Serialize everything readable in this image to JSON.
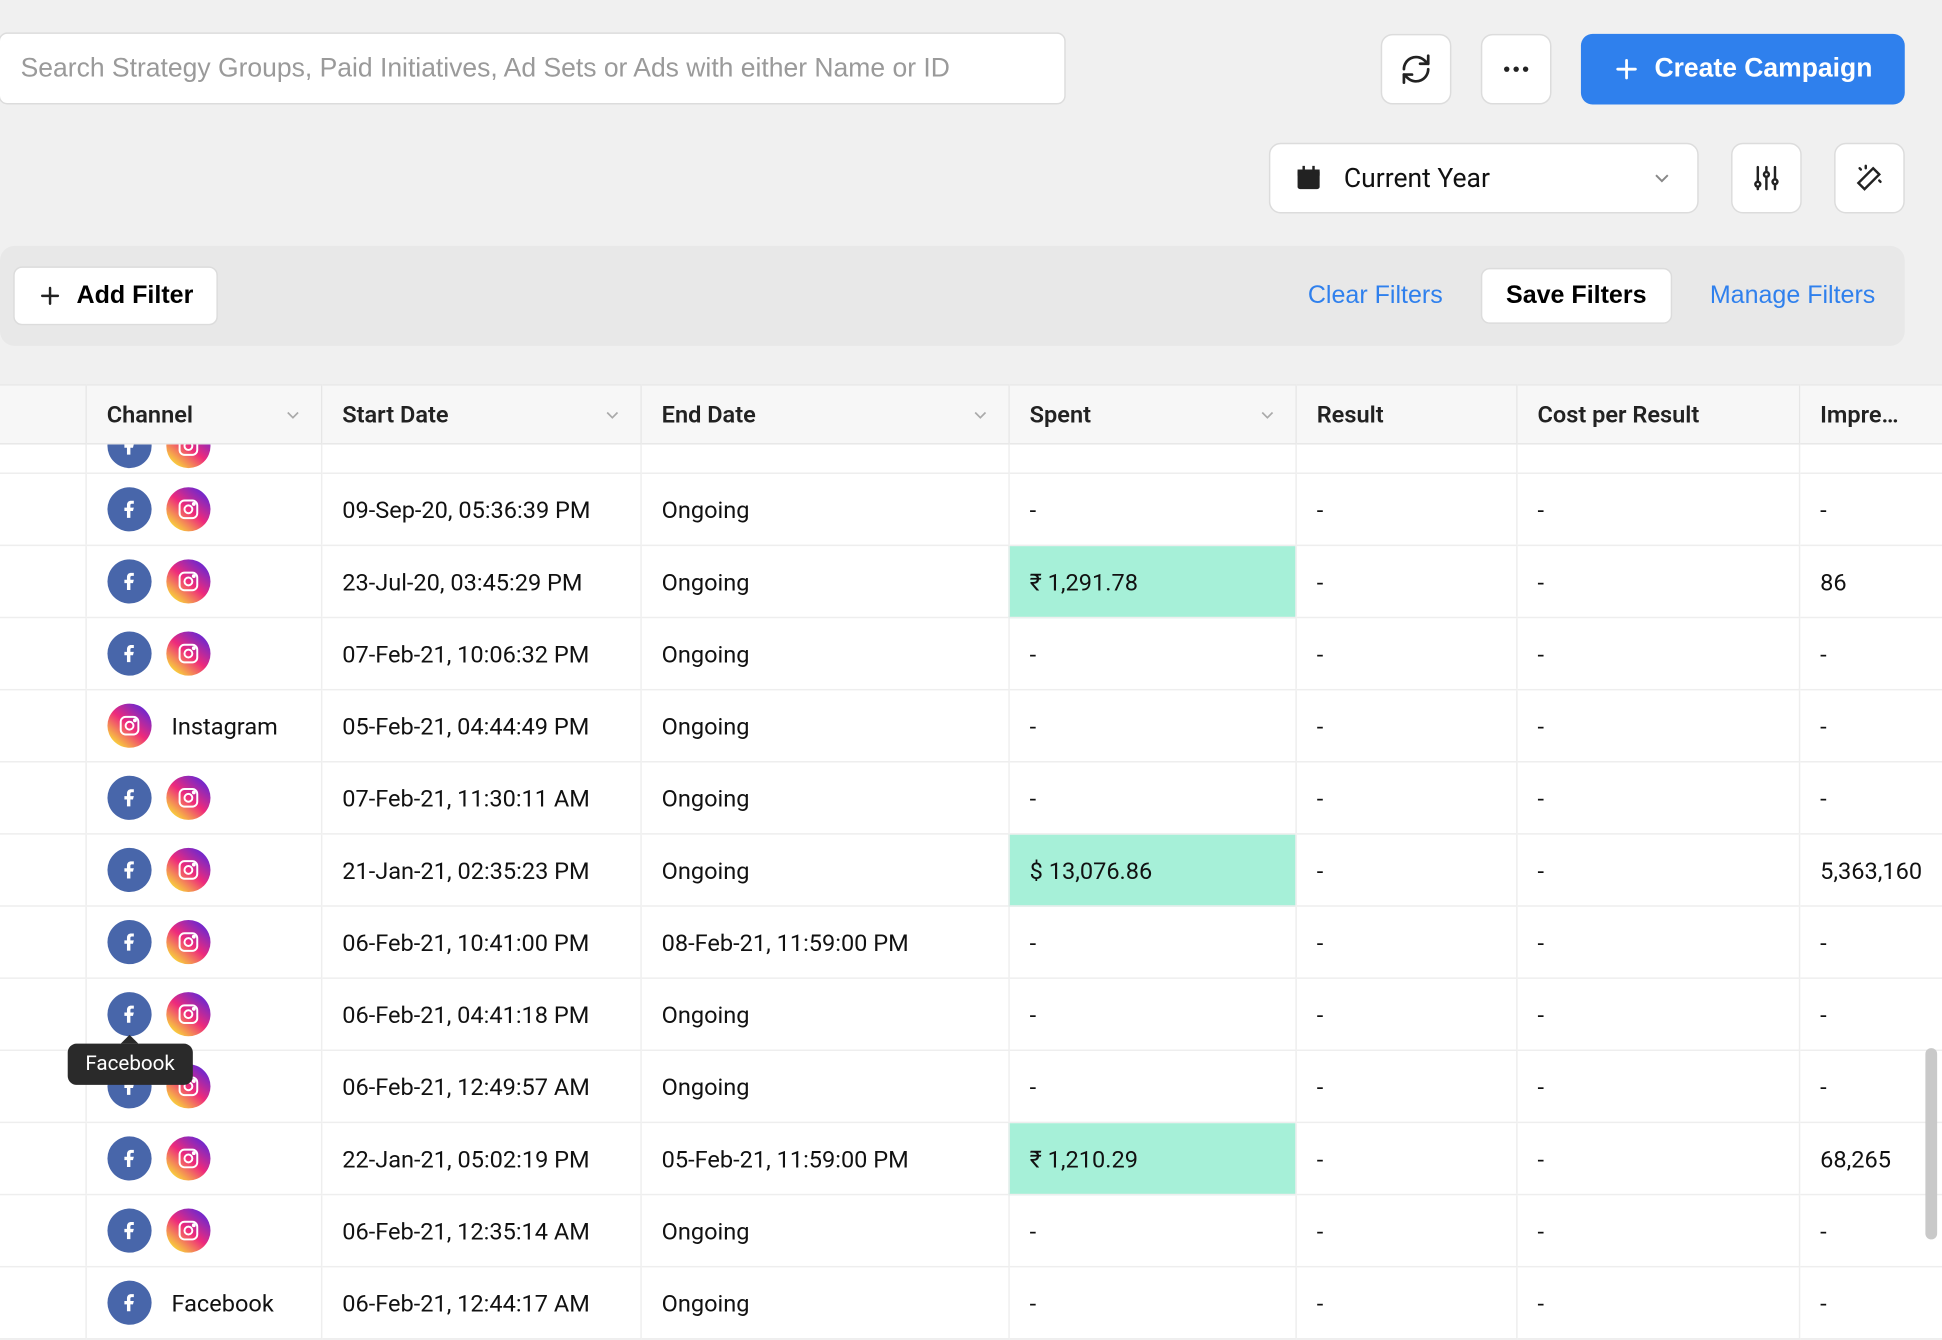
{
  "search": {
    "placeholder": "Search Strategy Groups, Paid Initiatives, Ad Sets or Ads with either Name or ID"
  },
  "header": {
    "create_label": "Create Campaign",
    "date_label": "Current Year"
  },
  "filters": {
    "add_label": "Add Filter",
    "clear_label": "Clear Filters",
    "save_label": "Save Filters",
    "manage_label": "Manage Filters"
  },
  "tooltip": "Facebook",
  "columns": {
    "channel": "Channel",
    "start": "Start Date",
    "end": "End Date",
    "spent": "Spent",
    "result": "Result",
    "cpr": "Cost per Result",
    "impr": "Impre…"
  },
  "rows": [
    {
      "channel": [
        "fb",
        "ig"
      ],
      "start": "09-Sep-20, 05:36:39 PM",
      "end": "Ongoing",
      "spent": "-",
      "spent_hl": false,
      "result": "-",
      "cpr": "-",
      "impr": "-"
    },
    {
      "channel": [
        "fb",
        "ig"
      ],
      "start": "23-Jul-20, 03:45:29 PM",
      "end": "Ongoing",
      "spent": "₹ 1,291.78",
      "spent_hl": true,
      "result": "-",
      "cpr": "-",
      "impr": "86"
    },
    {
      "channel": [
        "fb",
        "ig"
      ],
      "start": "07-Feb-21, 10:06:32 PM",
      "end": "Ongoing",
      "spent": "-",
      "spent_hl": false,
      "result": "-",
      "cpr": "-",
      "impr": "-"
    },
    {
      "channel": [
        "ig"
      ],
      "channel_label": "Instagram",
      "start": "05-Feb-21, 04:44:49 PM",
      "end": "Ongoing",
      "spent": "-",
      "spent_hl": false,
      "result": "-",
      "cpr": "-",
      "impr": "-"
    },
    {
      "channel": [
        "fb",
        "ig"
      ],
      "start": "07-Feb-21, 11:30:11 AM",
      "end": "Ongoing",
      "spent": "-",
      "spent_hl": false,
      "result": "-",
      "cpr": "-",
      "impr": "-"
    },
    {
      "channel": [
        "fb",
        "ig"
      ],
      "start": "21-Jan-21, 02:35:23 PM",
      "end": "Ongoing",
      "spent": "$ 13,076.86",
      "spent_hl": true,
      "result": "-",
      "cpr": "-",
      "impr": "5,363,160"
    },
    {
      "channel": [
        "fb",
        "ig"
      ],
      "start": "06-Feb-21, 10:41:00 PM",
      "end": "08-Feb-21, 11:59:00 PM",
      "spent": "-",
      "spent_hl": false,
      "result": "-",
      "cpr": "-",
      "impr": "-"
    },
    {
      "channel": [
        "fb",
        "ig"
      ],
      "start": "06-Feb-21, 04:41:18 PM",
      "end": "Ongoing",
      "spent": "-",
      "spent_hl": false,
      "result": "-",
      "cpr": "-",
      "impr": "-"
    },
    {
      "channel": [
        "fb",
        "ig"
      ],
      "start": "06-Feb-21, 12:49:57 AM",
      "end": "Ongoing",
      "spent": "-",
      "spent_hl": false,
      "result": "-",
      "cpr": "-",
      "impr": "-"
    },
    {
      "channel": [
        "fb",
        "ig"
      ],
      "start": "22-Jan-21, 05:02:19 PM",
      "end": "05-Feb-21, 11:59:00 PM",
      "spent": "₹ 1,210.29",
      "spent_hl": true,
      "result": "-",
      "cpr": "-",
      "impr": "68,265"
    },
    {
      "channel": [
        "fb",
        "ig"
      ],
      "start": "06-Feb-21, 12:35:14 AM",
      "end": "Ongoing",
      "spent": "-",
      "spent_hl": false,
      "result": "-",
      "cpr": "-",
      "impr": "-"
    },
    {
      "channel": [
        "fb"
      ],
      "channel_label": "Facebook",
      "start": "06-Feb-21, 12:44:17 AM",
      "end": "Ongoing",
      "spent": "-",
      "spent_hl": false,
      "result": "-",
      "cpr": "-",
      "impr": "-"
    }
  ]
}
